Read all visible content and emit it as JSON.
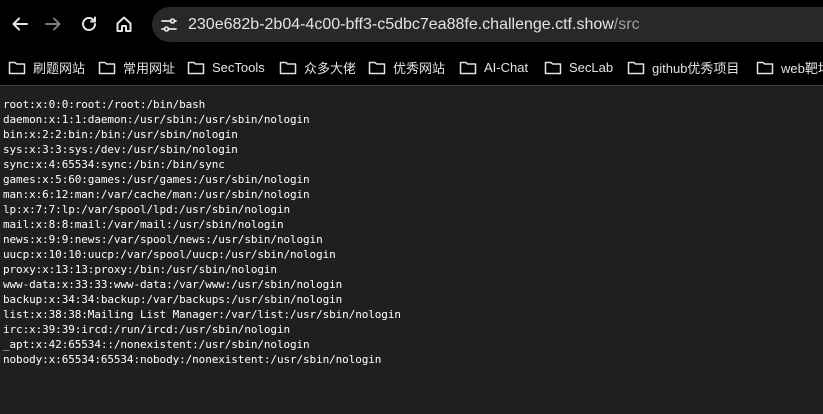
{
  "browser": {
    "url_host": "230e682b-2b04-4c00-bff3-c5dbc7ea88fe.challenge.ctf.show",
    "url_path": "/src",
    "nav_icons": [
      "back-arrow-icon",
      "forward-arrow-icon",
      "reload-icon",
      "home-icon",
      "site-settings-icon"
    ]
  },
  "bookmarks": [
    {
      "label": "刷题网站"
    },
    {
      "label": "常用网址"
    },
    {
      "label": "SecTools"
    },
    {
      "label": "众多大佬"
    },
    {
      "label": "优秀网站"
    },
    {
      "label": "AI-Chat"
    },
    {
      "label": "SecLab"
    },
    {
      "label": "github优秀项目"
    },
    {
      "label": "web靶场"
    }
  ],
  "page": {
    "lines": [
      "root:x:0:0:root:/root:/bin/bash",
      "daemon:x:1:1:daemon:/usr/sbin:/usr/sbin/nologin",
      "bin:x:2:2:bin:/bin:/usr/sbin/nologin",
      "sys:x:3:3:sys:/dev:/usr/sbin/nologin",
      "sync:x:4:65534:sync:/bin:/bin/sync",
      "games:x:5:60:games:/usr/games:/usr/sbin/nologin",
      "man:x:6:12:man:/var/cache/man:/usr/sbin/nologin",
      "lp:x:7:7:lp:/var/spool/lpd:/usr/sbin/nologin",
      "mail:x:8:8:mail:/var/mail:/usr/sbin/nologin",
      "news:x:9:9:news:/var/spool/news:/usr/sbin/nologin",
      "uucp:x:10:10:uucp:/var/spool/uucp:/usr/sbin/nologin",
      "proxy:x:13:13:proxy:/bin:/usr/sbin/nologin",
      "www-data:x:33:33:www-data:/var/www:/usr/sbin/nologin",
      "backup:x:34:34:backup:/var/backups:/usr/sbin/nologin",
      "list:x:38:38:Mailing List Manager:/var/list:/usr/sbin/nologin",
      "irc:x:39:39:ircd:/run/ircd:/usr/sbin/nologin",
      "_apt:x:42:65534::/nonexistent:/usr/sbin/nologin",
      "nobody:x:65534:65534:nobody:/nonexistent:/usr/sbin/nologin"
    ]
  },
  "colors": {
    "toolbar_bg": "#000000",
    "omnibox_bg": "#282828",
    "page_bg": "#1f1f1f",
    "text": "#ffffff"
  }
}
